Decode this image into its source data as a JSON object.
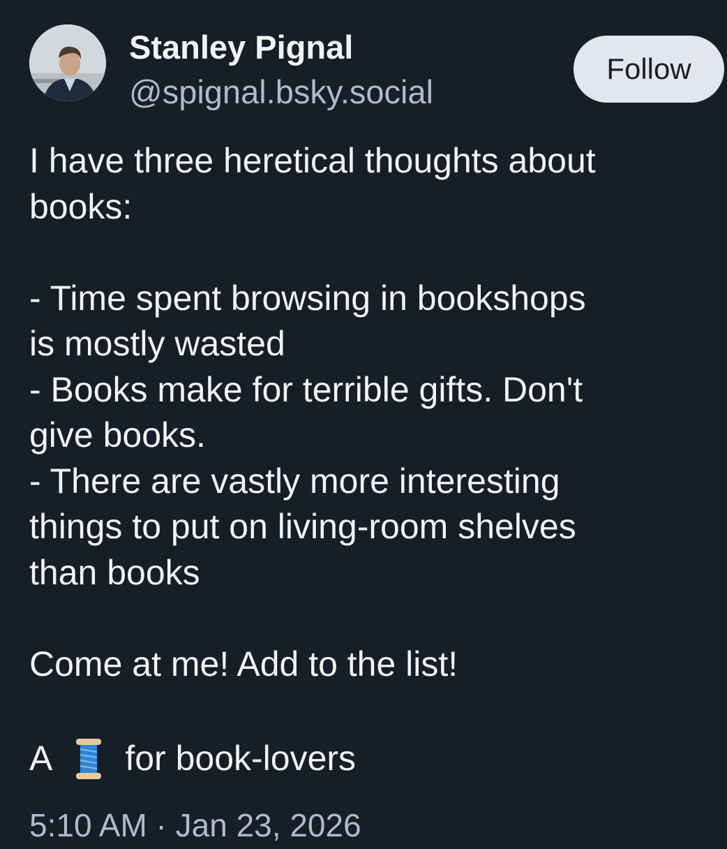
{
  "author": {
    "name": "Stanley Pignal",
    "handle": "@spignal.bsky.social"
  },
  "follow_button": {
    "label": "Follow"
  },
  "post": {
    "lines": [
      "I have three heretical thoughts about",
      "books:",
      "",
      "- Time spent browsing in bookshops",
      "is mostly wasted",
      "- Books make for terrible gifts. Don't",
      "give books.",
      "- There are vastly more interesting",
      "things to put on living-room shelves",
      "than books",
      "",
      "Come at me! Add to the list!"
    ],
    "thread_prefix": "A",
    "thread_icon": "spool-of-thread-icon",
    "thread_suffix": "for book-lovers"
  },
  "timestamp": "5:10 AM · Jan 23, 2026",
  "colors": {
    "background": "#161e27",
    "text": "#f1f3f5",
    "muted": "#aebbc9",
    "follow_button_bg": "#e2e7ee"
  }
}
